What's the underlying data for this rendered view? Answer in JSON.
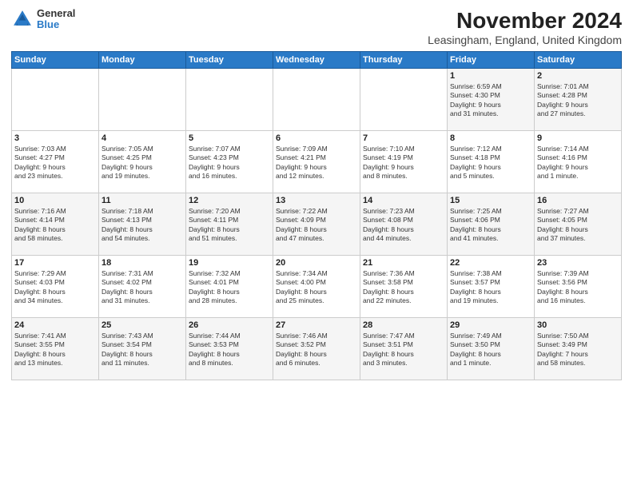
{
  "header": {
    "title": "November 2024",
    "subtitle": "Leasingham, England, United Kingdom",
    "logo_general": "General",
    "logo_blue": "Blue"
  },
  "columns": [
    "Sunday",
    "Monday",
    "Tuesday",
    "Wednesday",
    "Thursday",
    "Friday",
    "Saturday"
  ],
  "weeks": [
    [
      {
        "day": "",
        "info": ""
      },
      {
        "day": "",
        "info": ""
      },
      {
        "day": "",
        "info": ""
      },
      {
        "day": "",
        "info": ""
      },
      {
        "day": "",
        "info": ""
      },
      {
        "day": "1",
        "info": "Sunrise: 6:59 AM\nSunset: 4:30 PM\nDaylight: 9 hours\nand 31 minutes."
      },
      {
        "day": "2",
        "info": "Sunrise: 7:01 AM\nSunset: 4:28 PM\nDaylight: 9 hours\nand 27 minutes."
      }
    ],
    [
      {
        "day": "3",
        "info": "Sunrise: 7:03 AM\nSunset: 4:27 PM\nDaylight: 9 hours\nand 23 minutes."
      },
      {
        "day": "4",
        "info": "Sunrise: 7:05 AM\nSunset: 4:25 PM\nDaylight: 9 hours\nand 19 minutes."
      },
      {
        "day": "5",
        "info": "Sunrise: 7:07 AM\nSunset: 4:23 PM\nDaylight: 9 hours\nand 16 minutes."
      },
      {
        "day": "6",
        "info": "Sunrise: 7:09 AM\nSunset: 4:21 PM\nDaylight: 9 hours\nand 12 minutes."
      },
      {
        "day": "7",
        "info": "Sunrise: 7:10 AM\nSunset: 4:19 PM\nDaylight: 9 hours\nand 8 minutes."
      },
      {
        "day": "8",
        "info": "Sunrise: 7:12 AM\nSunset: 4:18 PM\nDaylight: 9 hours\nand 5 minutes."
      },
      {
        "day": "9",
        "info": "Sunrise: 7:14 AM\nSunset: 4:16 PM\nDaylight: 9 hours\nand 1 minute."
      }
    ],
    [
      {
        "day": "10",
        "info": "Sunrise: 7:16 AM\nSunset: 4:14 PM\nDaylight: 8 hours\nand 58 minutes."
      },
      {
        "day": "11",
        "info": "Sunrise: 7:18 AM\nSunset: 4:13 PM\nDaylight: 8 hours\nand 54 minutes."
      },
      {
        "day": "12",
        "info": "Sunrise: 7:20 AM\nSunset: 4:11 PM\nDaylight: 8 hours\nand 51 minutes."
      },
      {
        "day": "13",
        "info": "Sunrise: 7:22 AM\nSunset: 4:09 PM\nDaylight: 8 hours\nand 47 minutes."
      },
      {
        "day": "14",
        "info": "Sunrise: 7:23 AM\nSunset: 4:08 PM\nDaylight: 8 hours\nand 44 minutes."
      },
      {
        "day": "15",
        "info": "Sunrise: 7:25 AM\nSunset: 4:06 PM\nDaylight: 8 hours\nand 41 minutes."
      },
      {
        "day": "16",
        "info": "Sunrise: 7:27 AM\nSunset: 4:05 PM\nDaylight: 8 hours\nand 37 minutes."
      }
    ],
    [
      {
        "day": "17",
        "info": "Sunrise: 7:29 AM\nSunset: 4:03 PM\nDaylight: 8 hours\nand 34 minutes."
      },
      {
        "day": "18",
        "info": "Sunrise: 7:31 AM\nSunset: 4:02 PM\nDaylight: 8 hours\nand 31 minutes."
      },
      {
        "day": "19",
        "info": "Sunrise: 7:32 AM\nSunset: 4:01 PM\nDaylight: 8 hours\nand 28 minutes."
      },
      {
        "day": "20",
        "info": "Sunrise: 7:34 AM\nSunset: 4:00 PM\nDaylight: 8 hours\nand 25 minutes."
      },
      {
        "day": "21",
        "info": "Sunrise: 7:36 AM\nSunset: 3:58 PM\nDaylight: 8 hours\nand 22 minutes."
      },
      {
        "day": "22",
        "info": "Sunrise: 7:38 AM\nSunset: 3:57 PM\nDaylight: 8 hours\nand 19 minutes."
      },
      {
        "day": "23",
        "info": "Sunrise: 7:39 AM\nSunset: 3:56 PM\nDaylight: 8 hours\nand 16 minutes."
      }
    ],
    [
      {
        "day": "24",
        "info": "Sunrise: 7:41 AM\nSunset: 3:55 PM\nDaylight: 8 hours\nand 13 minutes."
      },
      {
        "day": "25",
        "info": "Sunrise: 7:43 AM\nSunset: 3:54 PM\nDaylight: 8 hours\nand 11 minutes."
      },
      {
        "day": "26",
        "info": "Sunrise: 7:44 AM\nSunset: 3:53 PM\nDaylight: 8 hours\nand 8 minutes."
      },
      {
        "day": "27",
        "info": "Sunrise: 7:46 AM\nSunset: 3:52 PM\nDaylight: 8 hours\nand 6 minutes."
      },
      {
        "day": "28",
        "info": "Sunrise: 7:47 AM\nSunset: 3:51 PM\nDaylight: 8 hours\nand 3 minutes."
      },
      {
        "day": "29",
        "info": "Sunrise: 7:49 AM\nSunset: 3:50 PM\nDaylight: 8 hours\nand 1 minute."
      },
      {
        "day": "30",
        "info": "Sunrise: 7:50 AM\nSunset: 3:49 PM\nDaylight: 7 hours\nand 58 minutes."
      }
    ]
  ]
}
